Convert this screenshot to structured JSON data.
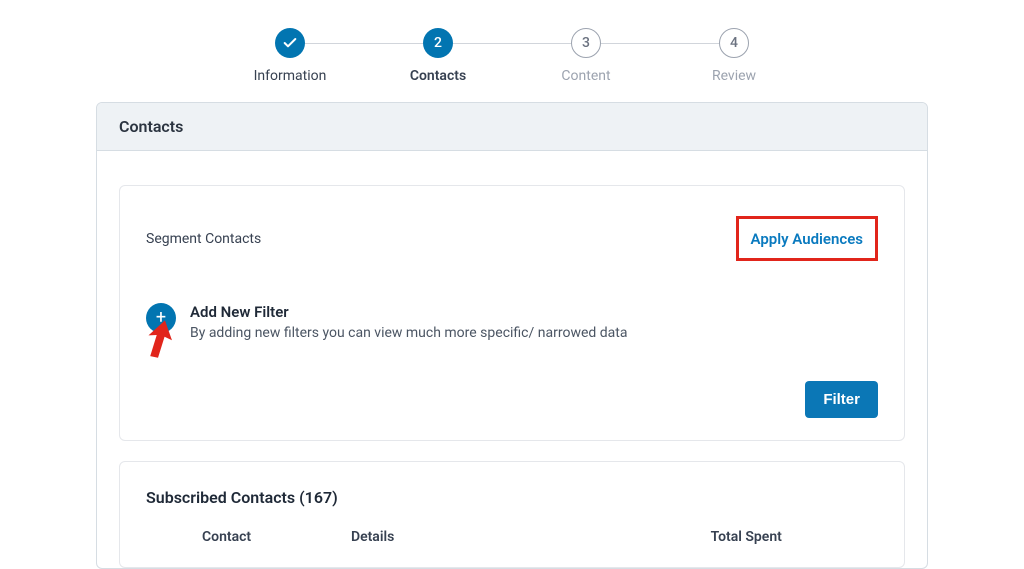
{
  "stepper": {
    "steps": [
      {
        "label": "Information",
        "icon": "check",
        "state": "done"
      },
      {
        "label": "Contacts",
        "number": "2",
        "state": "active"
      },
      {
        "label": "Content",
        "number": "3",
        "state": "pending"
      },
      {
        "label": "Review",
        "number": "4",
        "state": "pending"
      }
    ]
  },
  "panel": {
    "title": "Contacts"
  },
  "segment": {
    "title": "Segment Contacts",
    "apply_link": "Apply Audiences"
  },
  "add_filter": {
    "title": "Add New Filter",
    "description": "By adding new filters you can view much more specific/ narrowed data"
  },
  "buttons": {
    "filter": "Filter"
  },
  "subscribed": {
    "title": "Subscribed Contacts (167)",
    "columns": {
      "contact": "Contact",
      "details": "Details",
      "total_spent": "Total Spent"
    }
  }
}
